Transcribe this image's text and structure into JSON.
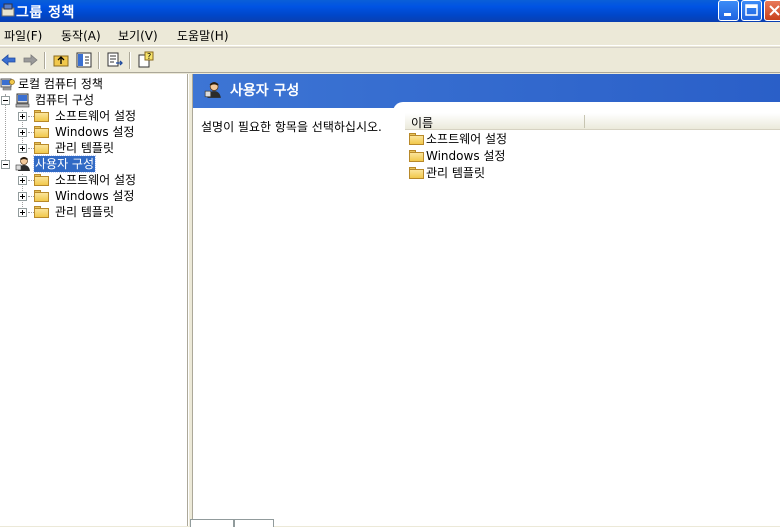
{
  "window": {
    "title": "그룹 정책",
    "controls": {
      "minimize": "minimize-icon",
      "maximize": "maximize-icon",
      "close": "close-icon"
    }
  },
  "menu": {
    "file": "파일(F)",
    "action": "동작(A)",
    "view": "보기(V)",
    "help": "도움말(H)"
  },
  "toolbar": {
    "buttons": [
      "back-arrow-icon",
      "forward-arrow-icon",
      "up-folder-icon",
      "show-hide-tree-icon",
      "export-list-icon",
      "help-icon"
    ]
  },
  "tree": {
    "root": "로컬 컴퓨터 정책",
    "computer_config": "컴퓨터 구성",
    "computer_children": [
      "소프트웨어 설정",
      "Windows 설정",
      "관리 템플릿"
    ],
    "user_config": "사용자 구성",
    "user_children": [
      "소프트웨어 설정",
      "Windows 설정",
      "관리 템플릿"
    ]
  },
  "details": {
    "banner_title": "사용자 구성",
    "description": "설명이 필요한 항목을 선택하십시오.",
    "column_name": "이름",
    "items": [
      "소프트웨어 설정",
      "Windows 설정",
      "관리 템플릿"
    ]
  },
  "colors": {
    "titlebar": "#0053e3",
    "selection": "#316ac5",
    "banner": "#3d75d4"
  }
}
